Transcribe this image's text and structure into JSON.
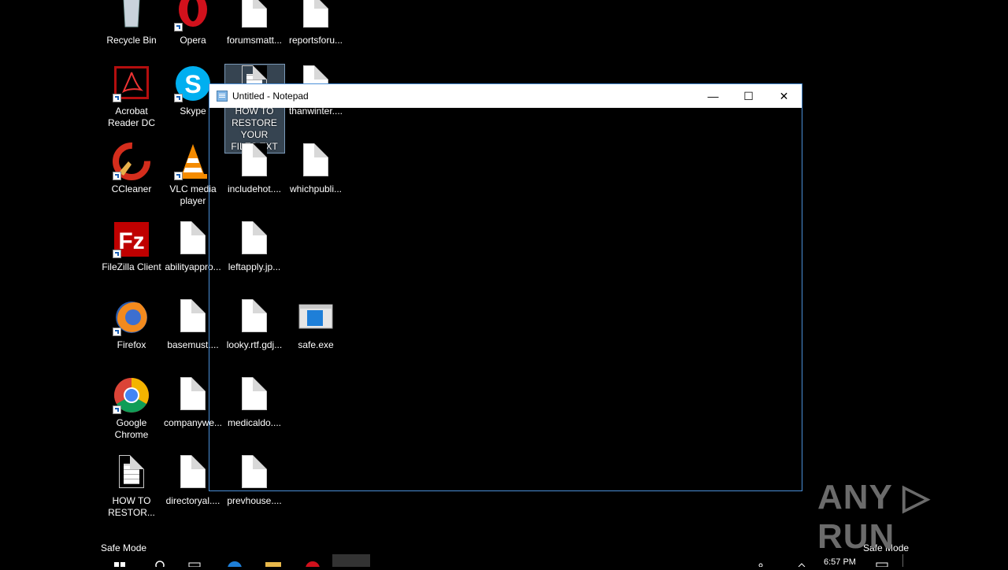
{
  "desktop": {
    "icons": [
      {
        "label": "Recycle Bin",
        "icon": "recycle-bin-icon"
      },
      {
        "label": "Opera",
        "icon": "opera-icon"
      },
      {
        "label": "forumsmatt...",
        "icon": "document-icon"
      },
      {
        "label": "reportsforu...",
        "icon": "document-icon"
      },
      {
        "label": "Acrobat Reader DC",
        "icon": "acrobat-icon"
      },
      {
        "label": "Skype",
        "icon": "skype-icon"
      },
      {
        "label": "HOW TO RESTORE YOUR FILES.TXT",
        "icon": "text-file-icon"
      },
      {
        "label": "thanwinter....",
        "icon": "document-icon"
      },
      {
        "label": "CCleaner",
        "icon": "ccleaner-icon"
      },
      {
        "label": "VLC media player",
        "icon": "vlc-icon"
      },
      {
        "label": "includehot....",
        "icon": "document-icon"
      },
      {
        "label": "whichpubli...",
        "icon": "document-icon"
      },
      {
        "label": "FileZilla Client",
        "icon": "filezilla-icon"
      },
      {
        "label": "abilityappro...",
        "icon": "document-icon"
      },
      {
        "label": "leftapply.jp...",
        "icon": "document-icon"
      },
      {
        "label": "Firefox",
        "icon": "firefox-icon"
      },
      {
        "label": "basemust....",
        "icon": "document-icon"
      },
      {
        "label": "looky.rtf.gdj...",
        "icon": "document-icon"
      },
      {
        "label": "safe.exe",
        "icon": "exe-icon"
      },
      {
        "label": "Google Chrome",
        "icon": "chrome-icon"
      },
      {
        "label": "companywe...",
        "icon": "document-icon"
      },
      {
        "label": "medicaldo....",
        "icon": "document-icon"
      },
      {
        "label": "HOW TO RESTOR...",
        "icon": "text-file-icon"
      },
      {
        "label": "directoryal....",
        "icon": "document-icon"
      },
      {
        "label": "prevhouse....",
        "icon": "document-icon"
      }
    ],
    "safe_mode_left": "Safe Mode",
    "safe_mode_right": "Safe Mode"
  },
  "notepad": {
    "title": "Untitled - Notepad",
    "minimize": "—",
    "maximize": "☐",
    "close": "✕"
  },
  "watermark": "ANY ▷ RUN",
  "taskbar": {
    "time": "6:57 PM"
  },
  "colors": {
    "desktop_bg": "#000000",
    "window_border": "#4a8fd8",
    "selection": "#7a99b8"
  }
}
